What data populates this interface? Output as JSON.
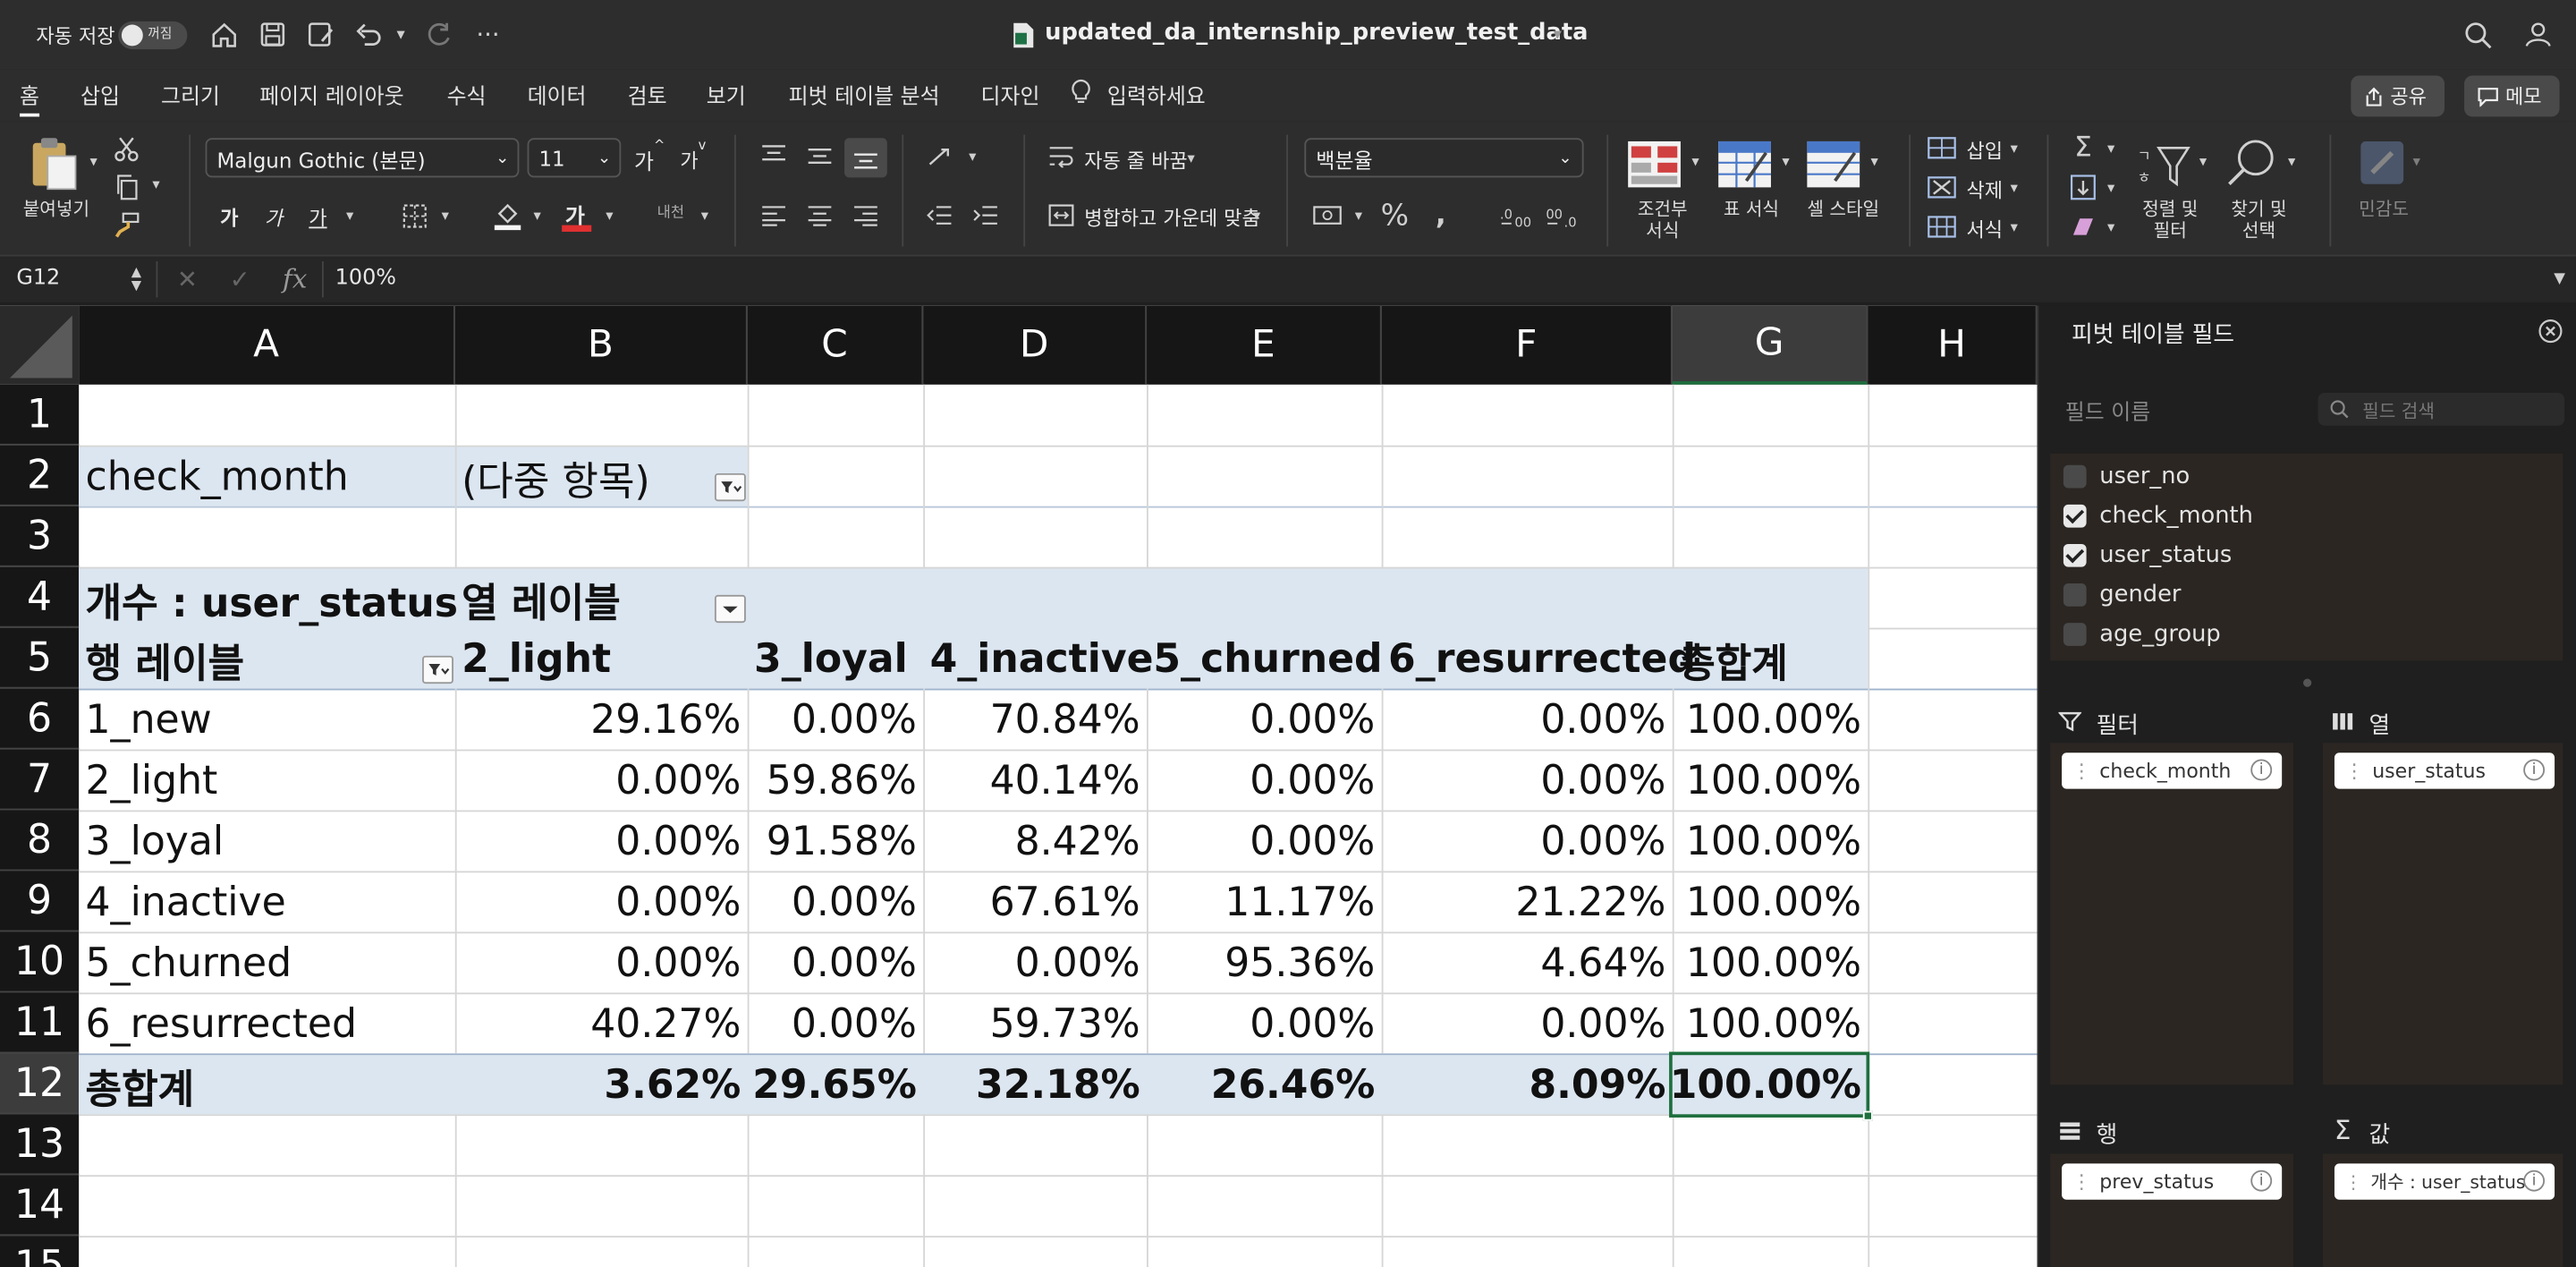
{
  "titlebar": {
    "autosave_label": "자동 저장",
    "autosave_state": "꺼짐",
    "file_title": "updated_da_internship_preview_test_data"
  },
  "menu": {
    "tabs": [
      "홈",
      "삽입",
      "그리기",
      "페이지 레이아웃",
      "수식",
      "데이터",
      "검토",
      "보기",
      "피벗 테이블 분석",
      "디자인"
    ],
    "tell_me": "입력하세요",
    "share": "공유",
    "comments": "메모"
  },
  "ribbon": {
    "paste": "붙여넣기",
    "font_name": "Malgun Gothic (본문)",
    "font_size": "11",
    "wrap_text": "자동 줄 바꿈",
    "merge_center": "병합하고 가운데 맞춤",
    "number_format": "백분율",
    "cond_format_1": "조건부",
    "cond_format_2": "서식",
    "table_format": "표 서식",
    "cell_style": "셀 스타일",
    "insert": "삽입",
    "delete": "삭제",
    "format": "서식",
    "sort_filter_1": "정렬 및",
    "sort_filter_2": "필터",
    "find_select_1": "찾기 및",
    "find_select_2": "선택",
    "sensitivity": "민감도",
    "bold_glyph": "가",
    "italic_glyph": "가",
    "underline_glyph": "가",
    "font_color_glyph": "가",
    "grow_font": "가",
    "shrink_font": "가",
    "phonetic": "내천"
  },
  "formula_bar": {
    "name_box": "G12",
    "fx": "fx",
    "formula": "100%"
  },
  "sheet": {
    "columns": [
      "A",
      "B",
      "C",
      "D",
      "E",
      "F",
      "G",
      "H"
    ],
    "rows": [
      "1",
      "2",
      "3",
      "4",
      "5",
      "6",
      "7",
      "8",
      "9",
      "10",
      "11",
      "12",
      "13",
      "14",
      "15"
    ],
    "filter_label": "check_month",
    "filter_value": "(다중 항목)",
    "value_label": "개수 : user_status",
    "col_labels": "열 레이블",
    "row_labels": "행 레이블",
    "col_headers": [
      "2_light",
      "3_loyal",
      "4_inactive",
      "5_churned",
      "6_resurrected",
      "총합계"
    ],
    "data_rows": [
      {
        "label": "1_new",
        "values": [
          "29.16%",
          "0.00%",
          "70.84%",
          "0.00%",
          "0.00%",
          "100.00%"
        ]
      },
      {
        "label": "2_light",
        "values": [
          "0.00%",
          "59.86%",
          "40.14%",
          "0.00%",
          "0.00%",
          "100.00%"
        ]
      },
      {
        "label": "3_loyal",
        "values": [
          "0.00%",
          "91.58%",
          "8.42%",
          "0.00%",
          "0.00%",
          "100.00%"
        ]
      },
      {
        "label": "4_inactive",
        "values": [
          "0.00%",
          "0.00%",
          "67.61%",
          "11.17%",
          "21.22%",
          "100.00%"
        ]
      },
      {
        "label": "5_churned",
        "values": [
          "0.00%",
          "0.00%",
          "0.00%",
          "95.36%",
          "4.64%",
          "100.00%"
        ]
      },
      {
        "label": "6_resurrected",
        "values": [
          "40.27%",
          "0.00%",
          "59.73%",
          "0.00%",
          "0.00%",
          "100.00%"
        ]
      }
    ],
    "total_row": {
      "label": "총합계",
      "values": [
        "3.62%",
        "29.65%",
        "32.18%",
        "26.46%",
        "8.09%",
        "100.00%"
      ]
    }
  },
  "pivot_pane": {
    "title": "피벗 테이블 필드",
    "field_name_label": "필드 이름",
    "search_placeholder": "필드 검색",
    "fields": [
      {
        "name": "user_no",
        "checked": false
      },
      {
        "name": "check_month",
        "checked": true
      },
      {
        "name": "user_status",
        "checked": true
      },
      {
        "name": "gender",
        "checked": false
      },
      {
        "name": "age_group",
        "checked": false
      }
    ],
    "filters_label": "필터",
    "columns_label": "열",
    "rows_label": "행",
    "values_label": "값",
    "filter_field": "check_month",
    "column_field": "user_status",
    "row_field": "prev_status",
    "value_field": "개수 : user_status",
    "info_glyph": "i"
  }
}
